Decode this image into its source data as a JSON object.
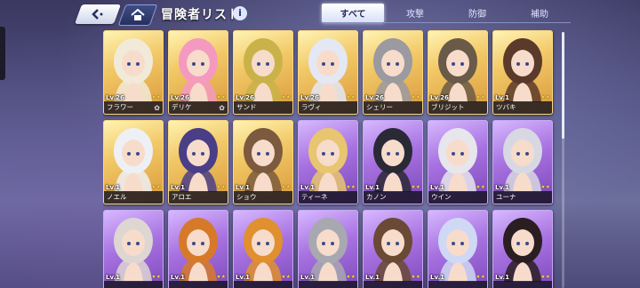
{
  "header": {
    "title": "冒険者リスト",
    "info_label": "i"
  },
  "tabs": [
    {
      "label": "すべて",
      "active": true
    },
    {
      "label": "攻撃",
      "active": false
    },
    {
      "label": "防御",
      "active": false
    },
    {
      "label": "補助",
      "active": false
    }
  ],
  "colors": {
    "gold_card": "#f2c866",
    "purple_card": "#a771e0",
    "active_tab": "#ffffff"
  },
  "adventurers": [
    {
      "name": "フラワー",
      "level": "Lv.26",
      "rarity": "gold",
      "hair": "#f2ead8",
      "emblem": true
    },
    {
      "name": "デリケ",
      "level": "Lv.26",
      "rarity": "gold",
      "hair": "#f49ac0",
      "emblem": true
    },
    {
      "name": "サンド",
      "level": "Lv.26",
      "rarity": "gold",
      "hair": "#c9b24a",
      "emblem": false
    },
    {
      "name": "ラヴィ",
      "level": "Lv.26",
      "rarity": "gold",
      "hair": "#e4e8f4",
      "emblem": false
    },
    {
      "name": "シェリー",
      "level": "Lv.26",
      "rarity": "gold",
      "hair": "#9a9aa0",
      "emblem": false
    },
    {
      "name": "ブリジット",
      "level": "Lv.26",
      "rarity": "gold",
      "hair": "#6a5a48",
      "emblem": false
    },
    {
      "name": "ツバキ",
      "level": "Lv.1",
      "rarity": "gold",
      "hair": "#5a3a2a",
      "emblem": false
    },
    {
      "name": "ノエル",
      "level": "Lv.1",
      "rarity": "gold",
      "hair": "#eef0f6",
      "emblem": false
    },
    {
      "name": "アロエ",
      "level": "Lv.1",
      "rarity": "gold",
      "hair": "#4a3f86",
      "emblem": false
    },
    {
      "name": "ショウ",
      "level": "Lv.1",
      "rarity": "gold",
      "hair": "#7b5a3e",
      "emblem": false
    },
    {
      "name": "ティーネ",
      "level": "Lv.1",
      "rarity": "purple",
      "hair": "#e8c570",
      "emblem": false
    },
    {
      "name": "カノン",
      "level": "Lv.1",
      "rarity": "purple",
      "hair": "#2a2a36",
      "emblem": false
    },
    {
      "name": "ウイン",
      "level": "Lv.1",
      "rarity": "purple",
      "hair": "#e6e6ec",
      "emblem": false
    },
    {
      "name": "ユーナ",
      "level": "Lv.1",
      "rarity": "purple",
      "hair": "#d8d8e2",
      "emblem": false
    },
    {
      "name": "",
      "level": "Lv.1",
      "rarity": "purple",
      "hair": "#ddd6d2",
      "emblem": false
    },
    {
      "name": "",
      "level": "Lv.1",
      "rarity": "purple",
      "hair": "#d67a2a",
      "emblem": false
    },
    {
      "name": "",
      "level": "Lv.1",
      "rarity": "purple",
      "hair": "#e0902e",
      "emblem": false
    },
    {
      "name": "",
      "level": "Lv.1",
      "rarity": "purple",
      "hair": "#a8a8b0",
      "emblem": false
    },
    {
      "name": "",
      "level": "Lv.1",
      "rarity": "purple",
      "hair": "#6a4a34",
      "emblem": false
    },
    {
      "name": "",
      "level": "Lv.1",
      "rarity": "purple",
      "hair": "#cfd8f4",
      "emblem": false
    },
    {
      "name": "",
      "level": "Lv.1",
      "rarity": "purple",
      "hair": "#2a1e22",
      "emblem": false
    }
  ]
}
